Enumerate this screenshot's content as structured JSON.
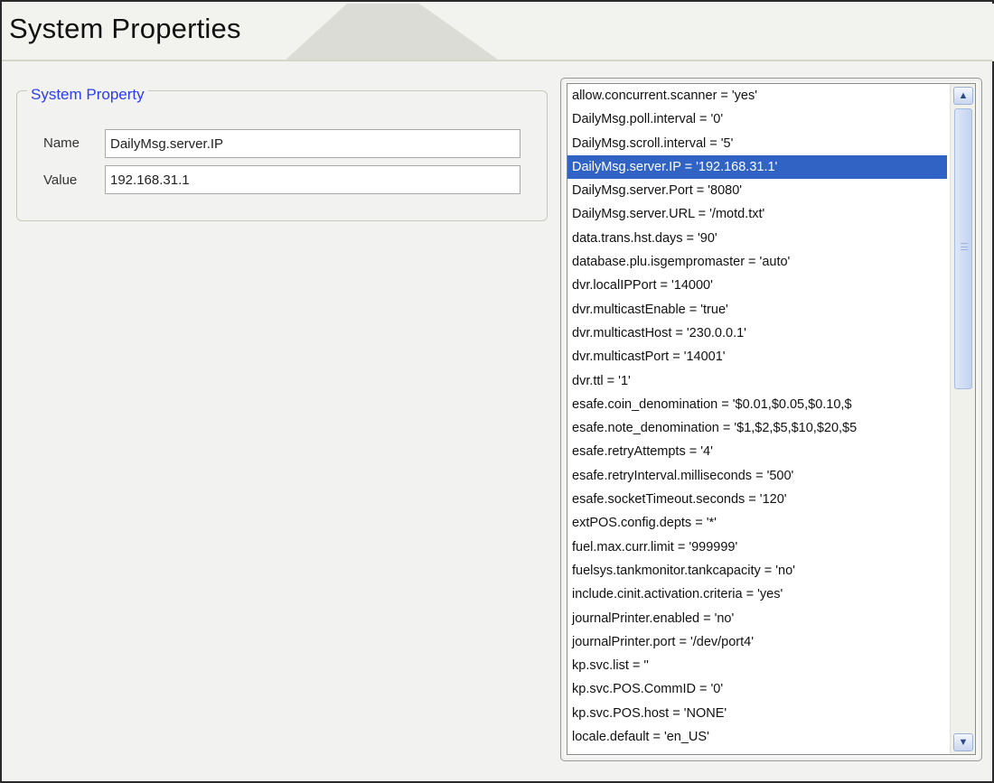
{
  "header": {
    "title": "System Properties"
  },
  "form": {
    "legend": "System Property",
    "name_label": "Name",
    "name_value": "DailyMsg.server.IP",
    "value_label": "Value",
    "value_value": "192.168.31.1"
  },
  "properties": {
    "selected_index": 3,
    "items": [
      "allow.concurrent.scanner = 'yes'",
      "DailyMsg.poll.interval = '0'",
      "DailyMsg.scroll.interval = '5'",
      "DailyMsg.server.IP = '192.168.31.1'",
      "DailyMsg.server.Port = '8080'",
      "DailyMsg.server.URL = '/motd.txt'",
      "data.trans.hst.days = '90'",
      "database.plu.isgempromaster = 'auto'",
      "dvr.localIPPort = '14000'",
      "dvr.multicastEnable = 'true'",
      "dvr.multicastHost = '230.0.0.1'",
      "dvr.multicastPort = '14001'",
      "dvr.ttl = '1'",
      "esafe.coin_denomination = '$0.01,$0.05,$0.10,$",
      "esafe.note_denomination = '$1,$2,$5,$10,$20,$5",
      "esafe.retryAttempts = '4'",
      "esafe.retryInterval.milliseconds = '500'",
      "esafe.socketTimeout.seconds = '120'",
      "extPOS.config.depts = '*'",
      "fuel.max.curr.limit = '999999'",
      "fuelsys.tankmonitor.tankcapacity = 'no'",
      "include.cinit.activation.criteria = 'yes'",
      "journalPrinter.enabled = 'no'",
      "journalPrinter.port = '/dev/port4'",
      "kp.svc.list = ''",
      "kp.svc.POS.CommID = '0'",
      "kp.svc.POS.host = 'NONE'",
      "locale.default = 'en_US'"
    ]
  },
  "scrollbar": {
    "up_icon": "▲",
    "down_icon": "▼"
  }
}
